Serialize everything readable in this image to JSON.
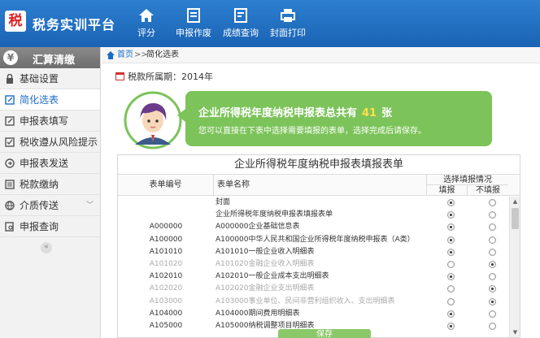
{
  "app": {
    "logo_char": "税",
    "title": "税务实训平台"
  },
  "nav": [
    {
      "label": "评分",
      "icon": "home-icon"
    },
    {
      "label": "申报作废",
      "icon": "document-cancel-icon"
    },
    {
      "label": "成绩查询",
      "icon": "document-search-icon"
    },
    {
      "label": "封面打印",
      "icon": "printer-icon"
    }
  ],
  "sidebar": {
    "header": "汇算清缴",
    "items": [
      {
        "label": "基础设置",
        "icon": "lock-icon"
      },
      {
        "label": "简化选表",
        "icon": "edit-icon",
        "active": true
      },
      {
        "label": "申报表填写",
        "icon": "edit-icon"
      },
      {
        "label": "税收遵从风险提示",
        "icon": "checklist-icon"
      },
      {
        "label": "申报表发送",
        "icon": "send-icon"
      },
      {
        "label": "税款缴纳",
        "icon": "list-icon"
      },
      {
        "label": "介质传送",
        "icon": "globe-icon",
        "has_chevron": true
      },
      {
        "label": "申报查询",
        "icon": "search-icon"
      }
    ]
  },
  "breadcrumb": {
    "home": "首页",
    "sep": ">>",
    "current": "简化选表"
  },
  "period": {
    "label": "税款所属期：2014年"
  },
  "banner": {
    "prefix": "企业所得税年度纳税申报表总共有",
    "count": "41",
    "suffix": "张",
    "hint": "您可以直接在下表中选择需要填报的表单，选择完成后请保存。"
  },
  "table": {
    "title": "企业所得税年度纳税申报表填报表单",
    "headers": {
      "code": "表单编号",
      "name": "表单名称",
      "select": "选择填报情况",
      "yes": "填报",
      "no": "不填报"
    },
    "rows": [
      {
        "code": "",
        "name": "封面",
        "dim": false,
        "fill": true
      },
      {
        "code": "",
        "name": "企业所得税年度纳税申报表填报表单",
        "dim": false,
        "fill": true
      },
      {
        "code": "A000000",
        "name": "A000000企业基础信息表",
        "dim": false,
        "fill": true
      },
      {
        "code": "A100000",
        "name": "A100000中华人民共和国企业所得税年度纳税申报表（A类）",
        "dim": false,
        "fill": true
      },
      {
        "code": "A101010",
        "name": "A101010一般企业收入明细表",
        "dim": false,
        "fill": true
      },
      {
        "code": "A101020",
        "name": "A101020金融企业收入明细表",
        "dim": true,
        "fill": false
      },
      {
        "code": "A102010",
        "name": "A102010一般企业成本支出明细表",
        "dim": false,
        "fill": true
      },
      {
        "code": "A102020",
        "name": "A102020金融企业支出明细表",
        "dim": true,
        "fill": false
      },
      {
        "code": "A103000",
        "name": "A103000事业单位、民间非营利组织收入、支出明细表",
        "dim": true,
        "fill": false
      },
      {
        "code": "A104000",
        "name": "A104000期间费用明细表",
        "dim": false,
        "fill": true
      },
      {
        "code": "A105000",
        "name": "A105000纳税调整项目明细表",
        "dim": false,
        "fill": true
      }
    ]
  },
  "confirm_label": "保存"
}
